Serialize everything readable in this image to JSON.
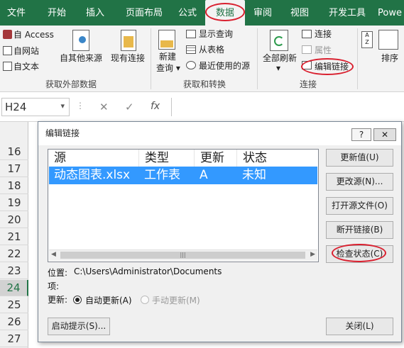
{
  "ribbon_tabs": [
    "文件",
    "开始",
    "插入",
    "页面布局",
    "公式",
    "数据",
    "审阅",
    "视图",
    "开发工具",
    "Powe"
  ],
  "active_tab": "数据",
  "external_data": {
    "access": "自 Access",
    "web": "自网站",
    "text": "自文本",
    "other_sources": "自其他来源",
    "existing_connections": "现有连接",
    "group_label": "获取外部数据"
  },
  "get_transform": {
    "new_query_line1": "新建",
    "new_query_line2": "查询",
    "show_queries": "显示查询",
    "from_table": "从表格",
    "recent_sources": "最近使用的源",
    "group_label": "获取和转换"
  },
  "connections": {
    "refresh_all": "全部刷新",
    "connections": "连接",
    "properties": "属性",
    "edit_links": "编辑链接",
    "group_label": "连接"
  },
  "sort": {
    "label": "排序"
  },
  "formula_bar": {
    "name_box": "H24",
    "cancel": "✕",
    "enter": "✓",
    "fx": "fx",
    "formula": ""
  },
  "row_headers": [
    "16",
    "17",
    "18",
    "19",
    "20",
    "21",
    "22",
    "23",
    "24",
    "25",
    "26",
    "27"
  ],
  "selected_row": "24",
  "dialog": {
    "title": "编辑链接",
    "help": "?",
    "close": "✕",
    "columns": [
      "源",
      "类型",
      "更新",
      "状态"
    ],
    "rows": [
      {
        "source": "动态图表.xlsx",
        "type": "工作表",
        "update": "A",
        "status": "未知"
      }
    ],
    "scroll_thumb": "|||",
    "buttons": {
      "update_values": "更新值(U)",
      "change_source": "更改源(N)...",
      "open_source": "打开源文件(O)",
      "break_link": "断开链接(B)",
      "check_status": "检查状态(C)",
      "startup_prompt": "启动提示(S)...",
      "close": "关闭(L)"
    },
    "location_label": "位置:",
    "location_value": "C:\\Users\\Administrator\\Documents",
    "item_label": "项:",
    "item_value": "",
    "update_label": "更新:",
    "auto_update": "自动更新(A)",
    "manual_update": "手动更新(M)"
  },
  "colors": {
    "excel_green": "#217346",
    "selection_blue": "#3399ff",
    "annotation_red": "#d9202f"
  }
}
